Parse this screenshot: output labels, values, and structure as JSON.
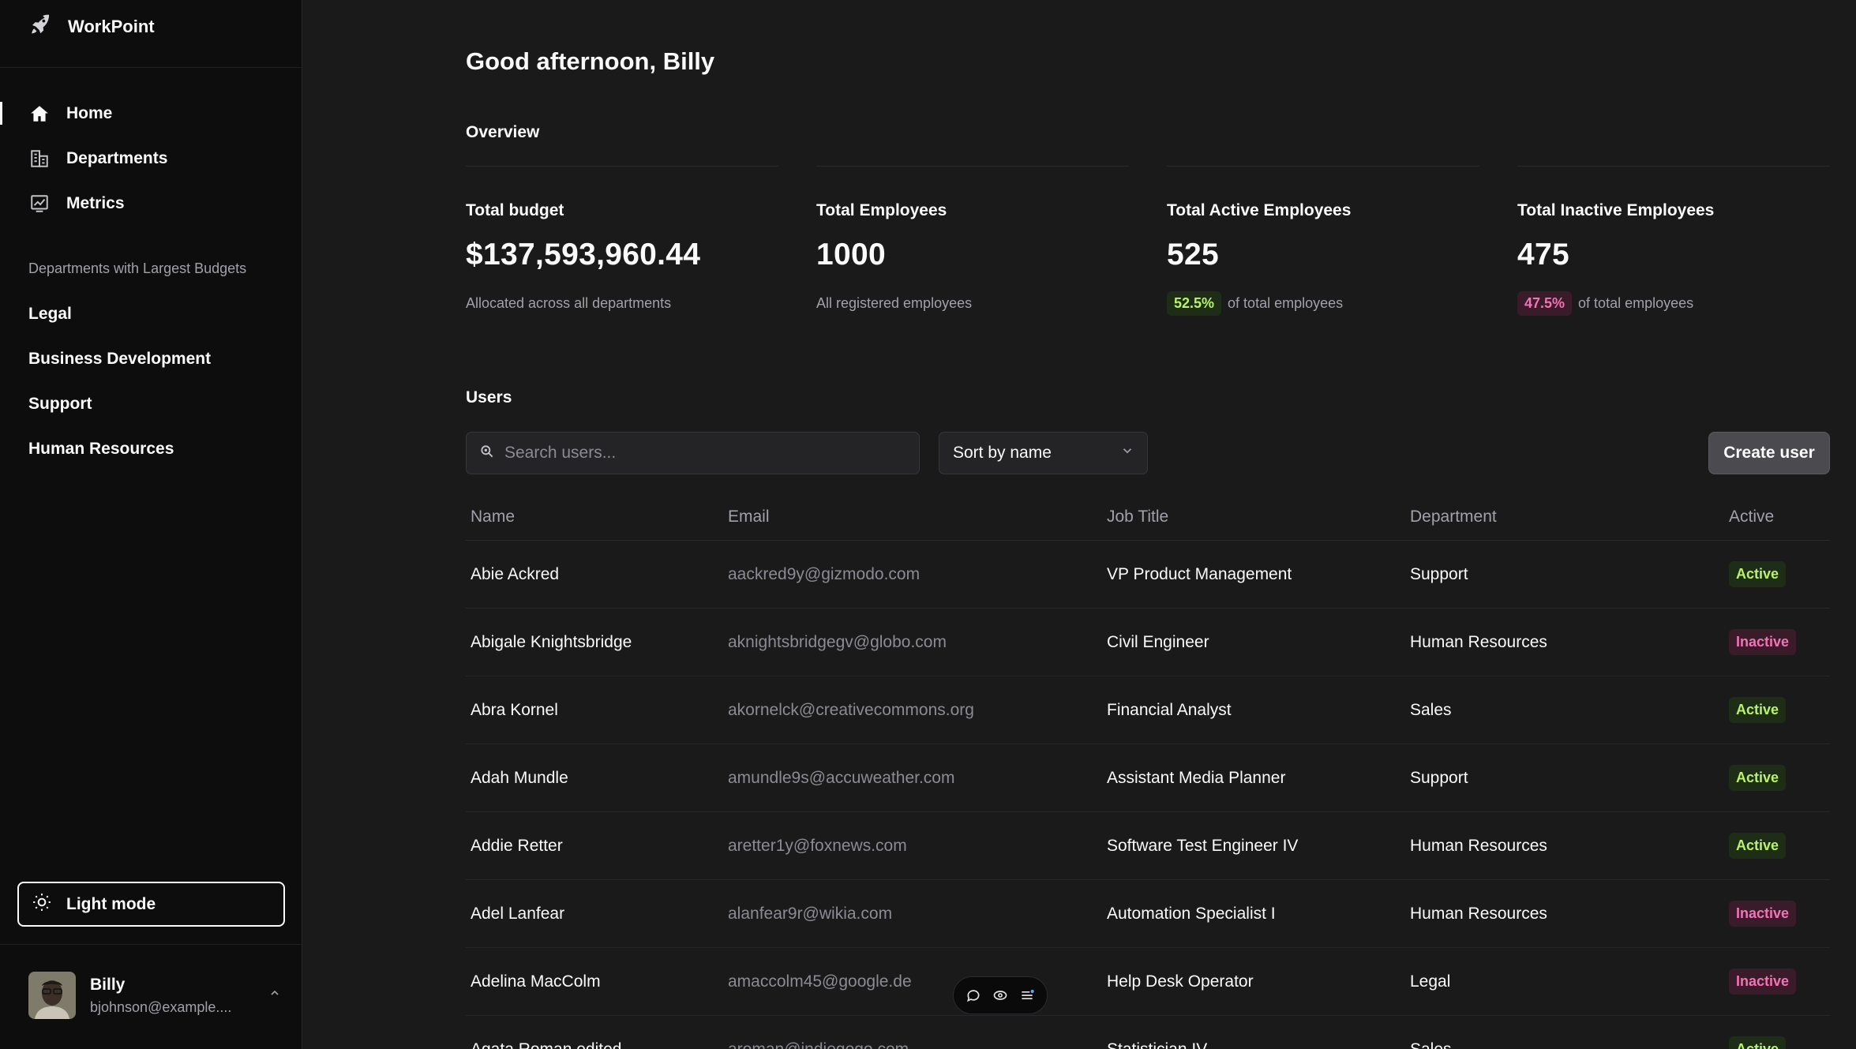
{
  "brand": {
    "name": "WorkPoint",
    "icon": "rocket-icon"
  },
  "nav": [
    {
      "label": "Home",
      "icon": "home-icon",
      "active": true
    },
    {
      "label": "Departments",
      "icon": "building-icon",
      "active": false
    },
    {
      "label": "Metrics",
      "icon": "chart-icon",
      "active": false
    }
  ],
  "departments": {
    "heading": "Departments with Largest Budgets",
    "items": [
      "Legal",
      "Business Development",
      "Support",
      "Human Resources"
    ]
  },
  "theme_toggle": {
    "label": "Light mode",
    "icon": "sun-icon"
  },
  "user": {
    "name": "Billy",
    "email": "bjohnson@example...."
  },
  "main": {
    "greeting": "Good afternoon, Billy",
    "overview_title": "Overview",
    "users_title": "Users"
  },
  "stats": [
    {
      "label": "Total budget",
      "value": "$137,593,960.44",
      "sub": "Allocated across all departments",
      "pill": ""
    },
    {
      "label": "Total Employees",
      "value": "1000",
      "sub": "All registered employees",
      "pill": ""
    },
    {
      "label": "Total Active Employees",
      "value": "525",
      "sub": "of total employees",
      "pill": "52.5%"
    },
    {
      "label": "Total Inactive Employees",
      "value": "475",
      "sub": "of total employees",
      "pill": "47.5%"
    }
  ],
  "toolbar": {
    "search_placeholder": "Search users...",
    "sort_label": "Sort by name",
    "create_label": "Create user"
  },
  "table": {
    "headers": {
      "name": "Name",
      "email": "Email",
      "job": "Job Title",
      "dept": "Department",
      "active": "Active"
    },
    "rows": [
      {
        "name": "Abie Ackred",
        "email": "aackred9y@gizmodo.com",
        "job": "VP Product Management",
        "dept": "Support",
        "status": "Active"
      },
      {
        "name": "Abigale Knightsbridge",
        "email": "aknightsbridgegv@globo.com",
        "job": "Civil Engineer",
        "dept": "Human Resources",
        "status": "Inactive"
      },
      {
        "name": "Abra Kornel",
        "email": "akornelck@creativecommons.org",
        "job": "Financial Analyst",
        "dept": "Sales",
        "status": "Active"
      },
      {
        "name": "Adah Mundle",
        "email": "amundle9s@accuweather.com",
        "job": "Assistant Media Planner",
        "dept": "Support",
        "status": "Active"
      },
      {
        "name": "Addie Retter",
        "email": "aretter1y@foxnews.com",
        "job": "Software Test Engineer IV",
        "dept": "Human Resources",
        "status": "Active"
      },
      {
        "name": "Adel Lanfear",
        "email": "alanfear9r@wikia.com",
        "job": "Automation Specialist I",
        "dept": "Human Resources",
        "status": "Inactive"
      },
      {
        "name": "Adelina MacColm",
        "email": "amaccolm45@google.de",
        "job": "Help Desk Operator",
        "dept": "Legal",
        "status": "Inactive"
      },
      {
        "name": "Agata Roman edited",
        "email": "aroman@indiegogo.com",
        "job": "Statistician IV",
        "dept": "Sales",
        "status": "Active"
      }
    ]
  },
  "colors": {
    "active": "#b8f36a",
    "inactive": "#f472b6",
    "background": "#1a1a1b",
    "sidebar": "#0d0d0e"
  }
}
